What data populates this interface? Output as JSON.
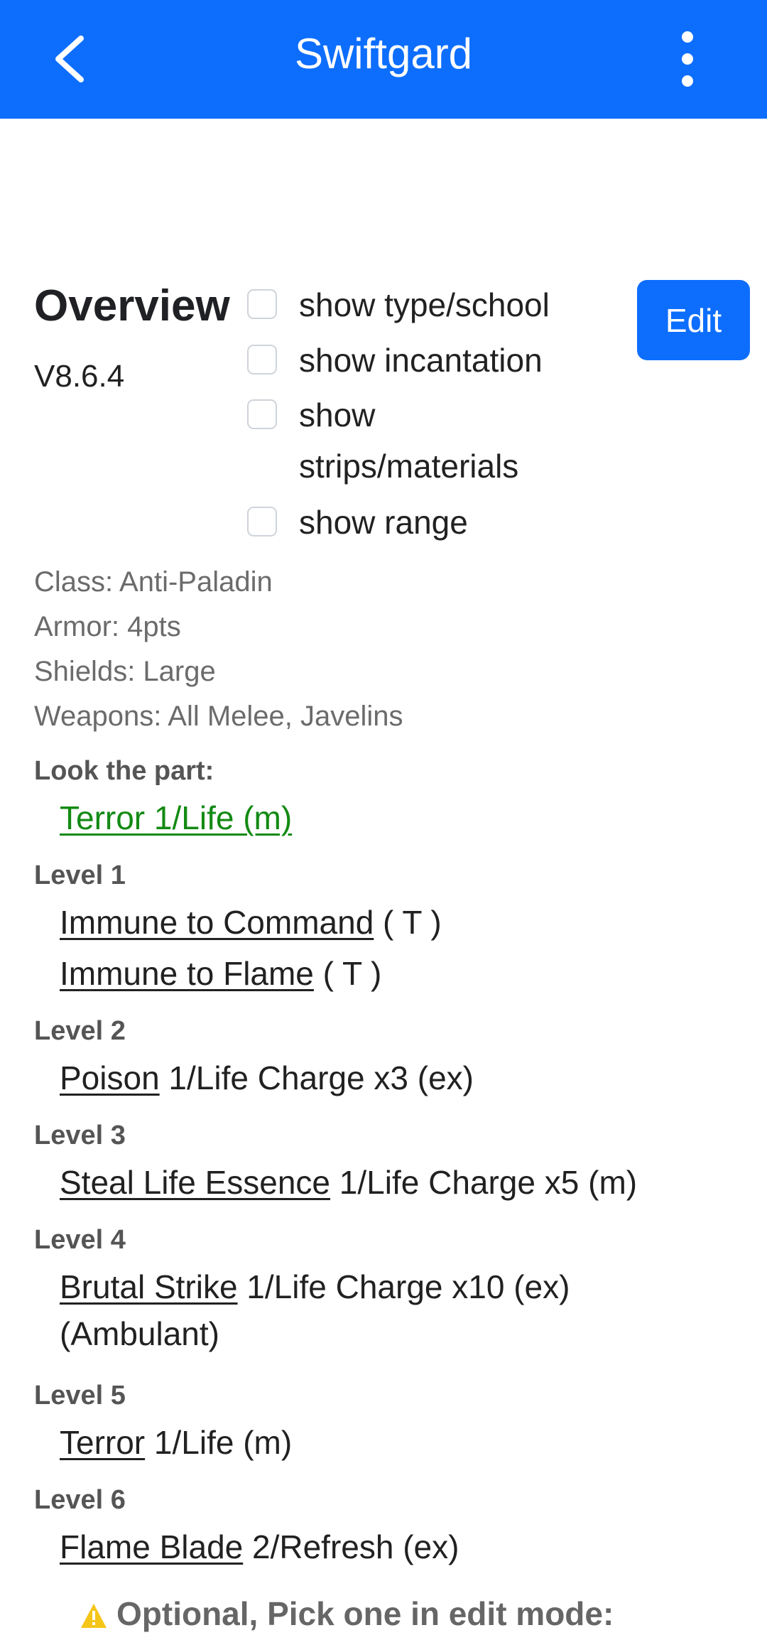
{
  "appbar": {
    "title": "Swiftgard",
    "back_icon": "chevron-left-icon",
    "menu_icon": "more-vert-icon"
  },
  "overview": {
    "heading": "Overview",
    "version": "V8.6.4",
    "edit_label": "Edit",
    "options": [
      {
        "label": "show type/school",
        "checked": false
      },
      {
        "label": "show incantation",
        "checked": false
      },
      {
        "label": "show strips/materials",
        "checked": false
      },
      {
        "label": "show range",
        "checked": false
      }
    ]
  },
  "meta": {
    "class": "Class: Anti-Paladin",
    "armor": "Armor: 4pts",
    "shields": "Shields: Large",
    "weapons": "Weapons: All Melee, Javelins"
  },
  "look_the_part": {
    "heading": "Look the part:",
    "link": "Terror 1/Life (m)"
  },
  "levels": [
    {
      "heading": "Level 1",
      "items": [
        {
          "link": "Immune to Command",
          "suffix": " ( T )"
        },
        {
          "link": "Immune to Flame",
          "suffix": " ( T )"
        }
      ]
    },
    {
      "heading": "Level 2",
      "items": [
        {
          "link": "Poison",
          "suffix": " 1/Life Charge x3 (ex)"
        }
      ]
    },
    {
      "heading": "Level 3",
      "items": [
        {
          "link": "Steal Life Essence",
          "suffix": " 1/Life Charge x5 (m)"
        }
      ]
    },
    {
      "heading": "Level 4",
      "items": [
        {
          "link": "Brutal Strike",
          "suffix": " 1/Life Charge x10 (ex) (Ambulant)"
        }
      ]
    },
    {
      "heading": "Level 5",
      "items": [
        {
          "link": "Terror",
          "suffix": " 1/Life (m)"
        }
      ]
    },
    {
      "heading": "Level 6",
      "items": [
        {
          "link": "Flame Blade",
          "suffix": " 2/Refresh (ex)"
        }
      ]
    }
  ],
  "notice": {
    "icon": "warning-icon",
    "icon_color": "#f5c518",
    "text": "Optional, Pick one in edit mode:"
  },
  "colors": {
    "primary": "#0d6efd",
    "link_green": "#138a13"
  }
}
